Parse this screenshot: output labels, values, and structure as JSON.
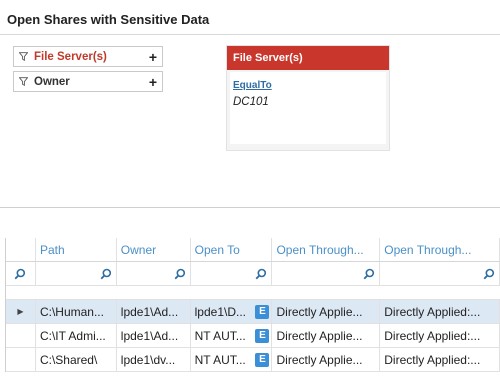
{
  "page": {
    "title": "Open Shares with Sensitive Data"
  },
  "filters": [
    {
      "label": "File Server(s)",
      "add": "+"
    },
    {
      "label": "Owner",
      "add": "+"
    }
  ],
  "filter_card": {
    "header": "File Server(s)",
    "operator": "EqualTo",
    "value": "DC101"
  },
  "grid": {
    "columns": [
      "Path",
      "Owner",
      "Open To",
      "Open Through...",
      "Open Through..."
    ],
    "rows": [
      {
        "path": "C:\\Human...",
        "owner": "lpde1\\Ad...",
        "open_to": "lpde1\\D...",
        "badge": "E",
        "through1": "Directly Applie...",
        "through2": "Directly Applied:..."
      },
      {
        "path": "C:\\IT Admi...",
        "owner": "lpde1\\Ad...",
        "open_to": "NT AUT...",
        "badge": "E",
        "through1": "Directly Applie...",
        "through2": "Directly Applied:..."
      },
      {
        "path": "C:\\Shared\\",
        "owner": "lpde1\\dv...",
        "open_to": "NT AUT...",
        "badge": "E",
        "through1": "Directly Applie...",
        "through2": "Directly Applied:..."
      }
    ],
    "current_row_marker": "▶"
  },
  "colors": {
    "accent_red": "#c9372c",
    "link_blue": "#2e6da4",
    "header_blue": "#4a90c8",
    "badge_blue": "#3a8fd6",
    "selected_row": "#dde8f5"
  }
}
